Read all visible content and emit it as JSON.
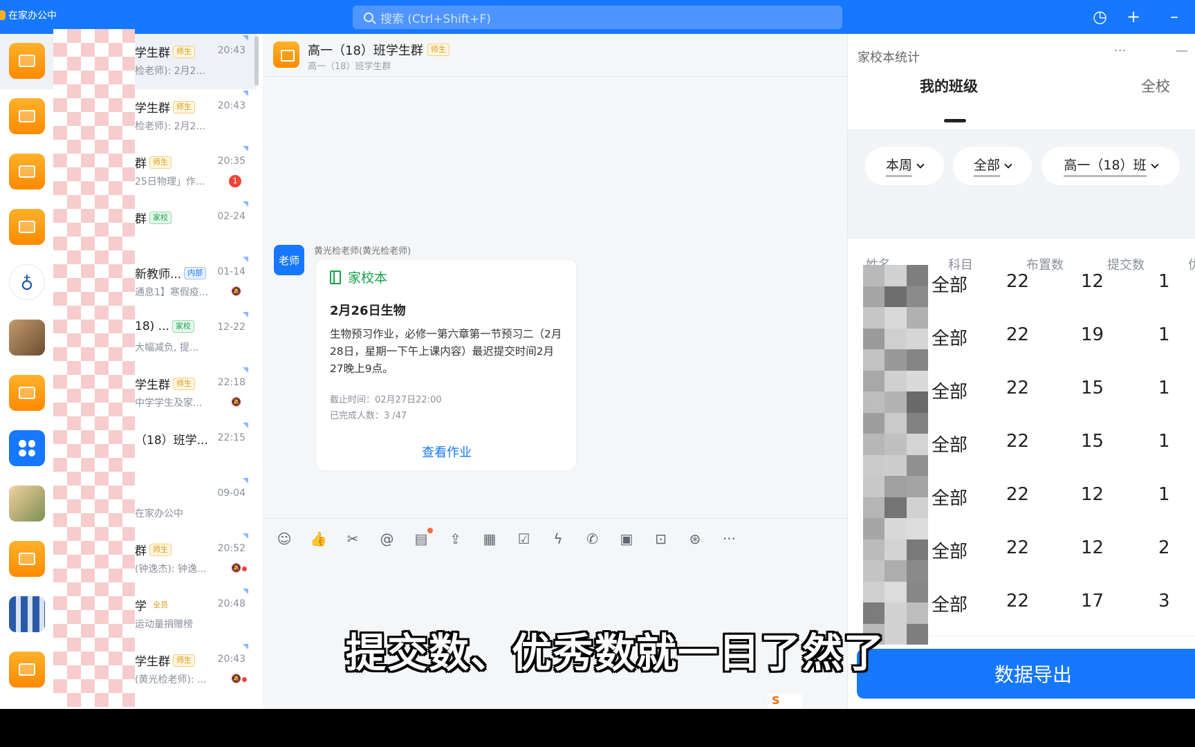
{
  "window": {
    "app_title": "在家办公中",
    "search_placeholder": "搜索 (Ctrl+Shift+F)",
    "icons": [
      "history-icon",
      "plus-icon",
      "minimize-icon"
    ]
  },
  "chat_list": [
    {
      "name": "学生群",
      "badge": "师生",
      "badge_type": "t",
      "time": "20:43",
      "preview": "检老师): 2月2...",
      "selected": true
    },
    {
      "name": "学生群",
      "badge": "师生",
      "badge_type": "t",
      "time": "20:43",
      "preview": "检老师): 2月2..."
    },
    {
      "name": "群",
      "badge": "师生",
      "badge_type": "t",
      "time": "20:35",
      "preview": "25日物理」作...",
      "unread": "1"
    },
    {
      "name": "群",
      "badge": "家校",
      "badge_type": "h",
      "time": "02-24",
      "preview": ""
    },
    {
      "name": "新教师...",
      "badge": "内部",
      "badge_type": "n",
      "time": "01-14",
      "preview": "通息1】寒假疫...",
      "muted": true
    },
    {
      "name": "18) ...",
      "badge": "家校",
      "badge_type": "h",
      "time": "12-22",
      "preview": "大幅减负, 提..."
    },
    {
      "name": "学生群",
      "badge": "师生",
      "badge_type": "t",
      "time": "22:18",
      "preview": "中学学生及家...",
      "muted": true
    },
    {
      "name": "（18）班学...",
      "badge": "",
      "badge_type": "",
      "time": "22:15",
      "preview": ""
    },
    {
      "name": "",
      "badge": "",
      "badge_type": "",
      "time": "09-04",
      "preview": "在家办公中"
    },
    {
      "name": "群",
      "badge": "师生",
      "badge_type": "t",
      "time": "20:52",
      "preview": "(钟逸杰): 钟逸...",
      "muted": true,
      "dot": true
    },
    {
      "name": "学",
      "badge": "全员",
      "badge_type": "q",
      "time": "20:48",
      "preview": "运动量捐赠榜"
    },
    {
      "name": "学生群",
      "badge": "师生",
      "badge_type": "t",
      "time": "20:43",
      "preview": "(黄光检老师): ...",
      "muted": true,
      "dot": true
    }
  ],
  "chat": {
    "title": "高一（18）班学生群",
    "title_badge": "师生",
    "subtitle": "高一（18）班学生群",
    "message": {
      "sender": "黄光检老师(黄光检老师)",
      "avatar_text": "老师",
      "card_type": "家校本",
      "card_title": "2月26日生物",
      "card_body": "生物预习作业，必修一第六章第一节预习二（2月28日，星期一下午上课内容）最迟提交时间2月27晚上9点。",
      "deadline": "截止时间：02月27日22:00",
      "completed": "已完成人数：3 /47",
      "action": "查看作业"
    },
    "toolbar_icons": [
      "emoji-icon",
      "thumbs-up-icon",
      "scissors-icon",
      "at-icon",
      "note-add-icon",
      "upload-icon",
      "calendar-icon",
      "checkbox-icon",
      "lightning-icon",
      "phone-icon",
      "live-icon",
      "screen-share-icon",
      "school-icon",
      "more-icon"
    ]
  },
  "subtitle_caption": "提交数、优秀数就一目了然了",
  "ime_label": "S",
  "panel": {
    "title": "家校本统计",
    "more": "···",
    "minimize": "—",
    "tabs": [
      "我的班级",
      "全校"
    ],
    "filters": [
      "本周",
      "全部",
      "高一（18）班"
    ],
    "columns": [
      "姓名",
      "科目",
      "布置数",
      "提交数",
      "优"
    ],
    "rows": [
      {
        "subject": "全部",
        "assigned": "22",
        "submitted": "12",
        "excellent": "1"
      },
      {
        "subject": "全部",
        "assigned": "22",
        "submitted": "19",
        "excellent": "1"
      },
      {
        "subject": "全部",
        "assigned": "22",
        "submitted": "15",
        "excellent": "1"
      },
      {
        "subject": "全部",
        "assigned": "22",
        "submitted": "15",
        "excellent": "1"
      },
      {
        "subject": "全部",
        "assigned": "22",
        "submitted": "12",
        "excellent": "1"
      },
      {
        "subject": "全部",
        "assigned": "22",
        "submitted": "12",
        "excellent": "2"
      },
      {
        "subject": "全部",
        "assigned": "22",
        "submitted": "17",
        "excellent": "3"
      }
    ],
    "export_label": "数据导出"
  },
  "colors": {
    "primary": "#1677ff",
    "orange": "#ff8a00",
    "green": "#16a34a"
  }
}
